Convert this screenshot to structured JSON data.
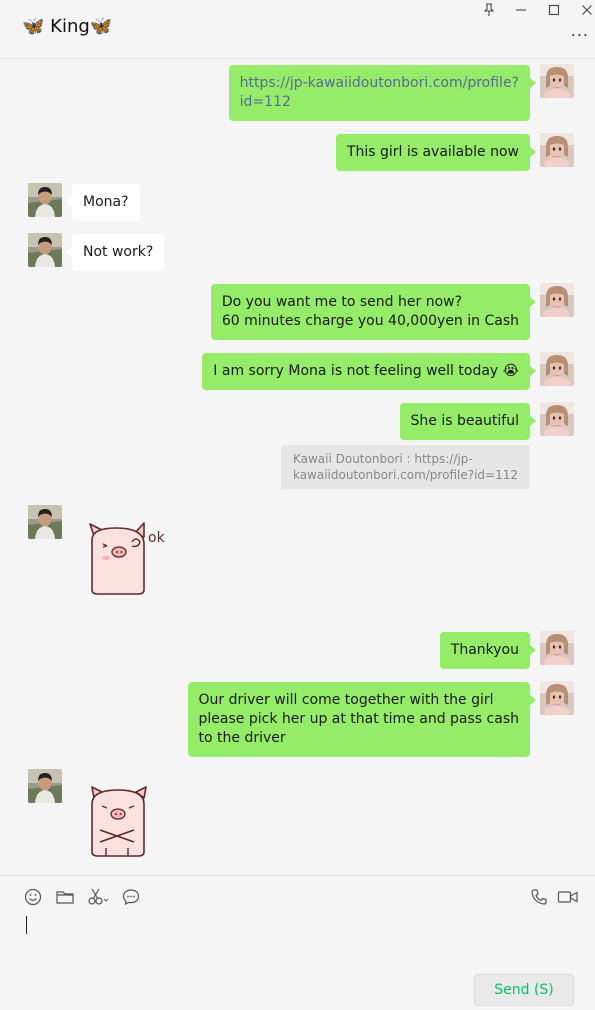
{
  "header": {
    "title": "🦋 King🦋",
    "pin_icon": "pin-icon",
    "minimize_icon": "minimize-icon",
    "maximize_icon": "maximize-icon",
    "close_icon": "close-icon",
    "more_label": "..."
  },
  "messages": [
    {
      "from": "me",
      "kind": "text",
      "text": "https://jp-kawaiidoutonbori.com/profile?\nid=112"
    },
    {
      "from": "me",
      "kind": "text",
      "text": "This girl is available now"
    },
    {
      "from": "them",
      "kind": "text",
      "text": "Mona?"
    },
    {
      "from": "them",
      "kind": "text",
      "text": "Not work?"
    },
    {
      "from": "me",
      "kind": "text",
      "text": "Do you want me to send her now?\n60 minutes charge you 40,000yen in Cash"
    },
    {
      "from": "me",
      "kind": "text",
      "text": "I am sorry Mona is not feeling well today 😭"
    },
    {
      "from": "me",
      "kind": "text",
      "text": "She is beautiful"
    },
    {
      "from": "me",
      "kind": "card",
      "text": "Kawaii Doutonbori : https://jp-\nkawaiidoutonbori.com/profile?id=112"
    },
    {
      "from": "them",
      "kind": "sticker",
      "sticker": "pig-ok-sticker",
      "text": "ok"
    },
    {
      "from": "me",
      "kind": "text",
      "text": "Thankyou"
    },
    {
      "from": "me",
      "kind": "text",
      "text": "Our driver will come together with the girl\nplease pick her up at that time and pass cash\nto the driver"
    },
    {
      "from": "them",
      "kind": "sticker",
      "sticker": "pig-crossed-arms-sticker"
    }
  ],
  "toolbar": {
    "emoji_icon": "emoji-icon",
    "folder_icon": "folder-icon",
    "scissors_icon": "scissors-icon",
    "chat_history_icon": "chat-history-icon",
    "voice_call_icon": "phone-icon",
    "video_call_icon": "video-icon"
  },
  "composer": {
    "value": ""
  },
  "send_button": {
    "label": "Send (S)"
  },
  "colors": {
    "my_bubble": "#95ec69",
    "their_bubble": "#ffffff",
    "link": "#576b95",
    "send_text": "#07c160"
  }
}
